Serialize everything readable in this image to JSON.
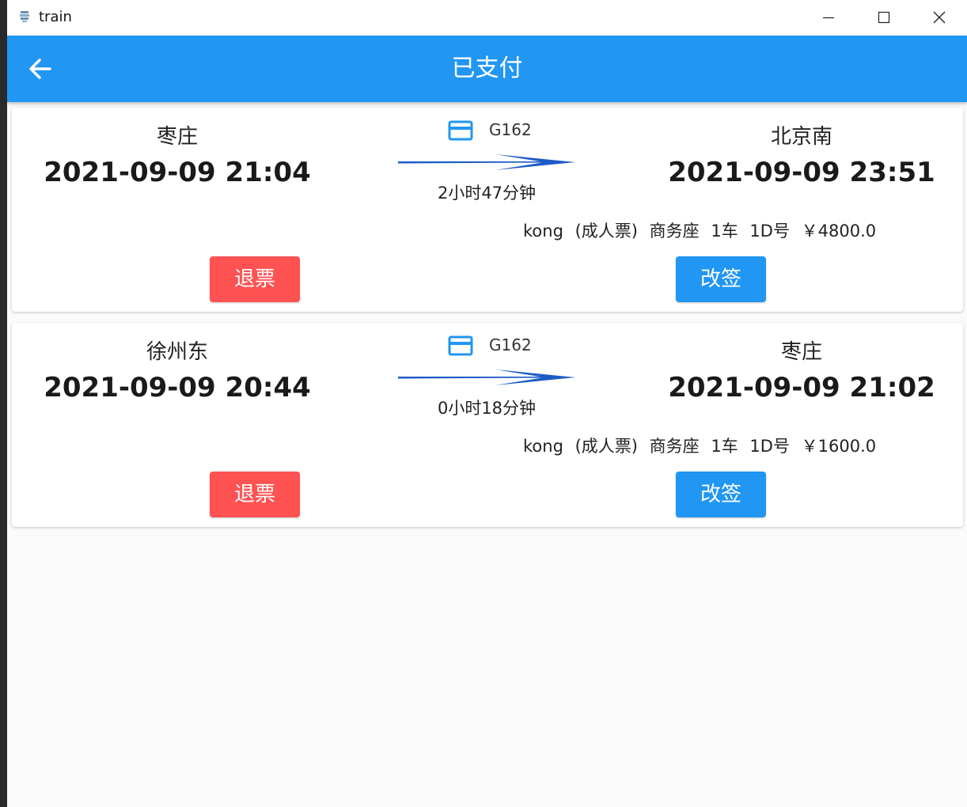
{
  "window": {
    "title": "train"
  },
  "appbar": {
    "title": "已支付"
  },
  "colors": {
    "primary": "#2196f3",
    "danger": "#ff5252",
    "arrow": "#1e5bc6"
  },
  "icons": {
    "back": "arrow-left-icon",
    "train": "card-icon"
  },
  "orders": [
    {
      "from_station": "枣庄",
      "from_time": "2021-09-09 21:04",
      "train_no": "G162",
      "duration": "2小时47分钟",
      "to_station": "北京南",
      "to_time": "2021-09-09 23:51",
      "passenger_name": "kong",
      "ticket_type": "(成人票)",
      "seat_class": "商务座",
      "car": "1车",
      "seat": "1D号",
      "price": "￥4800.0",
      "refund_label": "退票",
      "change_label": "改签"
    },
    {
      "from_station": "徐州东",
      "from_time": "2021-09-09 20:44",
      "train_no": "G162",
      "duration": "0小时18分钟",
      "to_station": "枣庄",
      "to_time": "2021-09-09 21:02",
      "passenger_name": "kong",
      "ticket_type": "(成人票)",
      "seat_class": "商务座",
      "car": "1车",
      "seat": "1D号",
      "price": "￥1600.0",
      "refund_label": "退票",
      "change_label": "改签"
    }
  ]
}
